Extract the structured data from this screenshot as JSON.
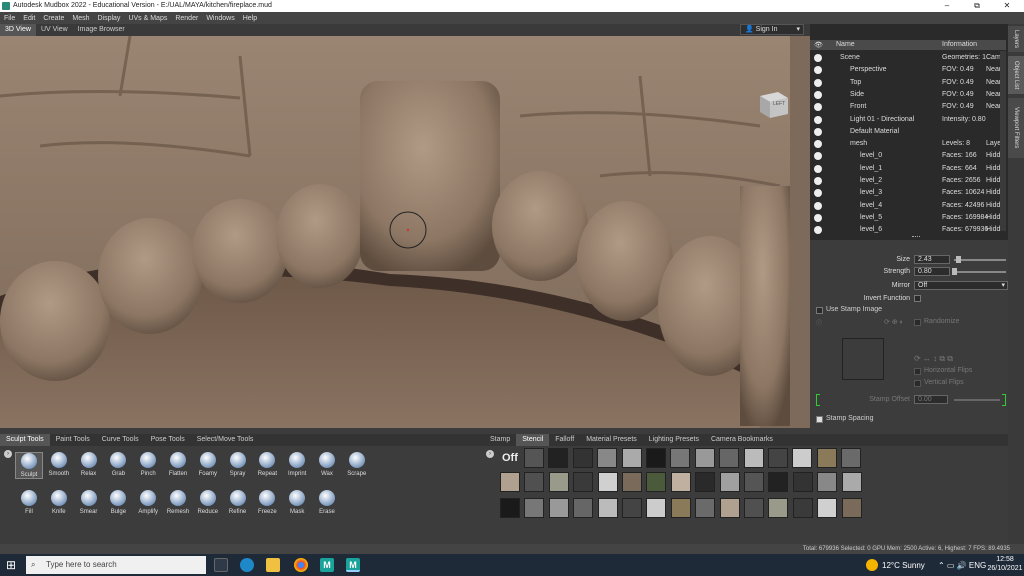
{
  "titlebar": {
    "title": "Autodesk Mudbox 2022 - Educational Version - E:/UAL/MAYA/kitchen/fireplace.mud",
    "minimize": "–",
    "maximize": "⧉",
    "close": "✕"
  },
  "menu": [
    "File",
    "Edit",
    "Create",
    "Mesh",
    "Display",
    "UVs & Maps",
    "Render",
    "Windows",
    "Help"
  ],
  "view_tabs": [
    "3D View",
    "UV View",
    "Image Browser"
  ],
  "signin": "Sign In",
  "viewcube": "LEFT",
  "right_tabs": [
    "Layers",
    "Object List",
    "Viewport Filters"
  ],
  "object_list": {
    "header_name": "Name",
    "header_info": "Information",
    "rows": [
      {
        "name": "Scene",
        "info": "Geometries: 1",
        "extra": "Came",
        "indent": 0
      },
      {
        "name": "Perspective",
        "info": "FOV: 0.49",
        "extra": "Near:",
        "indent": 1
      },
      {
        "name": "Top",
        "info": "FOV: 0.49",
        "extra": "Near:",
        "indent": 1
      },
      {
        "name": "Side",
        "info": "FOV: 0.49",
        "extra": "Near:",
        "indent": 1
      },
      {
        "name": "Front",
        "info": "FOV: 0.49",
        "extra": "Near:",
        "indent": 1
      },
      {
        "name": "Light 01 - Directional",
        "info": "Intensity: 0.80",
        "extra": "",
        "indent": 1
      },
      {
        "name": "Default Material",
        "info": "",
        "extra": "",
        "indent": 1
      },
      {
        "name": "mesh",
        "info": "Levels: 8",
        "extra": "Layer",
        "indent": 1
      },
      {
        "name": "level_0",
        "info": "Faces: 166",
        "extra": "Hidde",
        "indent": 2
      },
      {
        "name": "level_1",
        "info": "Faces: 664",
        "extra": "Hidde",
        "indent": 2
      },
      {
        "name": "level_2",
        "info": "Faces: 2656",
        "extra": "Hidde",
        "indent": 2
      },
      {
        "name": "level_3",
        "info": "Faces: 10624",
        "extra": "Hidde",
        "indent": 2
      },
      {
        "name": "level_4",
        "info": "Faces: 42496",
        "extra": "Hidde",
        "indent": 2
      },
      {
        "name": "level_5",
        "info": "Faces: 169984",
        "extra": "Hidde",
        "indent": 2
      },
      {
        "name": "level_6",
        "info": "Faces: 679936",
        "extra": "Hidde",
        "indent": 2
      }
    ]
  },
  "properties": {
    "size_label": "Size",
    "size_value": "2.43",
    "strength_label": "Strength",
    "strength_value": "0.80",
    "mirror_label": "Mirror",
    "mirror_value": "Off",
    "invert_label": "Invert Function",
    "stamp_image_label": "Use Stamp Image",
    "randomize_label": "Randomize",
    "horizontal_flips": "Horizontal Flips",
    "vertical_flips": "Vertical Flips",
    "stamp_offset_label": "Stamp Offset",
    "stamp_offset_value": "0.00",
    "stamp_spacing_label": "Stamp Spacing"
  },
  "tool_tabs": [
    "Sculpt Tools",
    "Paint Tools",
    "Curve Tools",
    "Pose Tools",
    "Select/Move Tools"
  ],
  "tools_row1": [
    "Sculpt",
    "Smooth",
    "Relax",
    "Grab",
    "Pinch",
    "Flatten",
    "Foamy",
    "Spray",
    "Repeat",
    "Imprint",
    "Wax",
    "Scrape"
  ],
  "tools_row2": [
    "Fill",
    "Knife",
    "Smear",
    "Bulge",
    "Amplify",
    "Remesh",
    "Reduce",
    "Refine",
    "Freeze",
    "Mask",
    "Erase"
  ],
  "stamp_tabs": [
    "Stamp",
    "Stencil",
    "Falloff",
    "Material Presets",
    "Lighting Presets",
    "Camera Bookmarks"
  ],
  "stamp_off": "Off",
  "status": "Total: 679936  Selected: 0 GPU Mem: 2500  Active: 6, Highest: 7  FPS: 89.4935",
  "taskbar": {
    "search_placeholder": "Type here to search",
    "weather": "12°C  Sunny",
    "time": "12:58",
    "date": "26/10/2021"
  }
}
